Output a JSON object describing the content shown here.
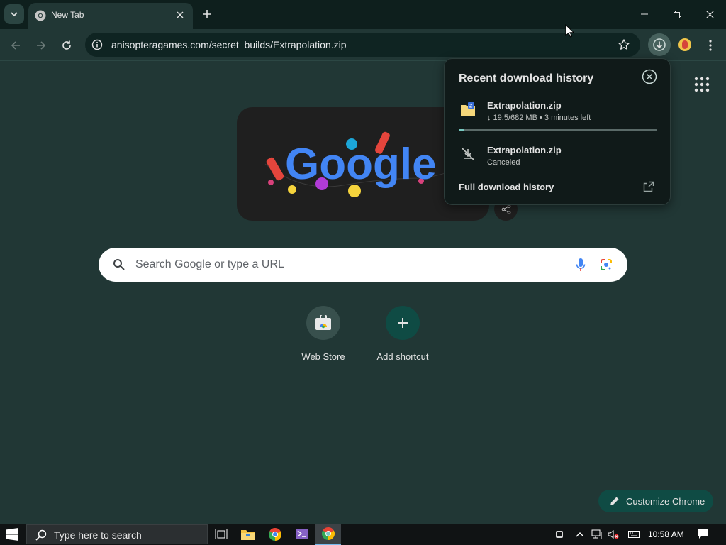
{
  "browser": {
    "tab": {
      "title": "New Tab",
      "favicon": "chrome-icon"
    },
    "address": {
      "url": "anisopteragames.com/secret_builds/Extrapolation.zip"
    }
  },
  "ntp": {
    "doodle_label": "Google",
    "search_placeholder": "Search Google or type a URL",
    "shortcuts": [
      {
        "label": "Web Store",
        "icon": "web-store-icon"
      },
      {
        "label": "Add shortcut",
        "icon": "plus-icon"
      }
    ],
    "customize_label": "Customize Chrome"
  },
  "downloads": {
    "title": "Recent download history",
    "items": [
      {
        "name": "Extrapolation.zip",
        "status": "↓ 19.5/682 MB • 3 minutes left",
        "progress": 0.029,
        "icon": "zip-file-icon"
      },
      {
        "name": "Extrapolation.zip",
        "status": "Canceled",
        "icon": "download-off-icon"
      }
    ],
    "full_history_label": "Full download history"
  },
  "taskbar": {
    "search_placeholder": "Type here to search",
    "time": "10:58 AM",
    "apps": [
      "task-view-icon",
      "file-explorer-icon",
      "chrome-icon",
      "visual-studio-icon",
      "chrome-beta-icon"
    ]
  },
  "colors": {
    "page_bg": "#213735",
    "titlebar_bg": "#0e1f1d",
    "accent": "#77c9c0",
    "customize_bg": "#0f4b44"
  }
}
